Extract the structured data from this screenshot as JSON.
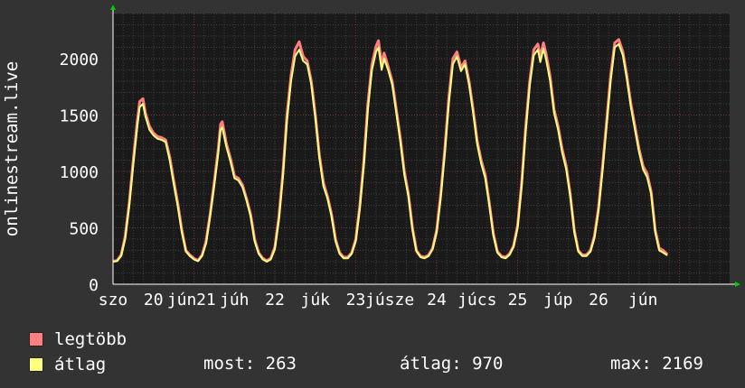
{
  "chart_data": {
    "type": "area",
    "ylabel": "onlinestream.live",
    "ylim": [
      0,
      2400
    ],
    "yticks": [
      0,
      500,
      1000,
      1500,
      2000
    ],
    "xlim": [
      0,
      7.62
    ],
    "xticks": [
      {
        "x": 0,
        "label": "szo"
      },
      {
        "x": 0.5,
        "label": "20"
      },
      {
        "x": 0.85,
        "label": "jún"
      },
      {
        "x": 1.15,
        "label": "21"
      },
      {
        "x": 1.5,
        "label": "júh"
      },
      {
        "x": 2.0,
        "label": "22"
      },
      {
        "x": 2.5,
        "label": "júk"
      },
      {
        "x": 3.0,
        "label": "23"
      },
      {
        "x": 3.42,
        "label": "júsze"
      },
      {
        "x": 4.0,
        "label": "24"
      },
      {
        "x": 4.5,
        "label": "júcs"
      },
      {
        "x": 5.0,
        "label": "25"
      },
      {
        "x": 5.5,
        "label": "júp"
      },
      {
        "x": 6.0,
        "label": "26"
      },
      {
        "x": 6.55,
        "label": "jún"
      }
    ],
    "grid": true,
    "series": [
      {
        "name": "legtöbb",
        "color": "#ff7f7f",
        "points": [
          [
            0.0,
            205
          ],
          [
            0.05,
            210
          ],
          [
            0.1,
            260
          ],
          [
            0.15,
            420
          ],
          [
            0.2,
            720
          ],
          [
            0.25,
            1100
          ],
          [
            0.3,
            1450
          ],
          [
            0.33,
            1620
          ],
          [
            0.37,
            1645
          ],
          [
            0.4,
            1520
          ],
          [
            0.45,
            1400
          ],
          [
            0.5,
            1340
          ],
          [
            0.55,
            1310
          ],
          [
            0.6,
            1300
          ],
          [
            0.65,
            1280
          ],
          [
            0.7,
            1130
          ],
          [
            0.75,
            920
          ],
          [
            0.8,
            720
          ],
          [
            0.85,
            480
          ],
          [
            0.9,
            300
          ],
          [
            0.95,
            260
          ],
          [
            1.0,
            230
          ],
          [
            1.05,
            210
          ],
          [
            1.1,
            260
          ],
          [
            1.15,
            380
          ],
          [
            1.2,
            620
          ],
          [
            1.25,
            900
          ],
          [
            1.3,
            1200
          ],
          [
            1.33,
            1420
          ],
          [
            1.35,
            1440
          ],
          [
            1.4,
            1250
          ],
          [
            1.45,
            1120
          ],
          [
            1.5,
            960
          ],
          [
            1.55,
            940
          ],
          [
            1.6,
            880
          ],
          [
            1.65,
            760
          ],
          [
            1.7,
            620
          ],
          [
            1.75,
            400
          ],
          [
            1.8,
            280
          ],
          [
            1.85,
            230
          ],
          [
            1.9,
            210
          ],
          [
            1.95,
            230
          ],
          [
            2.0,
            330
          ],
          [
            2.05,
            600
          ],
          [
            2.1,
            1000
          ],
          [
            2.15,
            1500
          ],
          [
            2.2,
            1850
          ],
          [
            2.25,
            2080
          ],
          [
            2.3,
            2150
          ],
          [
            2.35,
            2020
          ],
          [
            2.4,
            1980
          ],
          [
            2.45,
            1800
          ],
          [
            2.5,
            1500
          ],
          [
            2.55,
            1150
          ],
          [
            2.6,
            900
          ],
          [
            2.65,
            780
          ],
          [
            2.7,
            620
          ],
          [
            2.75,
            400
          ],
          [
            2.8,
            280
          ],
          [
            2.85,
            240
          ],
          [
            2.9,
            240
          ],
          [
            2.95,
            280
          ],
          [
            3.0,
            400
          ],
          [
            3.05,
            700
          ],
          [
            3.1,
            1100
          ],
          [
            3.15,
            1600
          ],
          [
            3.2,
            1950
          ],
          [
            3.25,
            2110
          ],
          [
            3.28,
            2160
          ],
          [
            3.32,
            1950
          ],
          [
            3.35,
            2050
          ],
          [
            3.4,
            1930
          ],
          [
            3.45,
            1800
          ],
          [
            3.5,
            1550
          ],
          [
            3.55,
            1300
          ],
          [
            3.6,
            1000
          ],
          [
            3.65,
            800
          ],
          [
            3.7,
            500
          ],
          [
            3.75,
            300
          ],
          [
            3.8,
            250
          ],
          [
            3.85,
            240
          ],
          [
            3.9,
            260
          ],
          [
            3.95,
            320
          ],
          [
            4.0,
            480
          ],
          [
            4.05,
            800
          ],
          [
            4.1,
            1200
          ],
          [
            4.15,
            1650
          ],
          [
            4.2,
            2000
          ],
          [
            4.25,
            2060
          ],
          [
            4.3,
            1920
          ],
          [
            4.35,
            1980
          ],
          [
            4.4,
            1800
          ],
          [
            4.45,
            1550
          ],
          [
            4.5,
            1270
          ],
          [
            4.55,
            1100
          ],
          [
            4.6,
            970
          ],
          [
            4.65,
            720
          ],
          [
            4.7,
            450
          ],
          [
            4.75,
            290
          ],
          [
            4.8,
            250
          ],
          [
            4.85,
            240
          ],
          [
            4.9,
            270
          ],
          [
            4.95,
            340
          ],
          [
            5.0,
            520
          ],
          [
            5.05,
            900
          ],
          [
            5.1,
            1400
          ],
          [
            5.15,
            1800
          ],
          [
            5.2,
            2080
          ],
          [
            5.25,
            2130
          ],
          [
            5.28,
            2020
          ],
          [
            5.32,
            2140
          ],
          [
            5.35,
            2050
          ],
          [
            5.4,
            1850
          ],
          [
            5.45,
            1550
          ],
          [
            5.5,
            1400
          ],
          [
            5.55,
            1200
          ],
          [
            5.6,
            1050
          ],
          [
            5.65,
            800
          ],
          [
            5.7,
            480
          ],
          [
            5.75,
            300
          ],
          [
            5.8,
            260
          ],
          [
            5.85,
            260
          ],
          [
            5.9,
            300
          ],
          [
            5.95,
            430
          ],
          [
            6.0,
            680
          ],
          [
            6.05,
            1050
          ],
          [
            6.1,
            1450
          ],
          [
            6.15,
            1850
          ],
          [
            6.2,
            2140
          ],
          [
            6.25,
            2170
          ],
          [
            6.3,
            2060
          ],
          [
            6.35,
            1850
          ],
          [
            6.4,
            1600
          ],
          [
            6.45,
            1400
          ],
          [
            6.5,
            1200
          ],
          [
            6.55,
            1050
          ],
          [
            6.6,
            980
          ],
          [
            6.65,
            820
          ],
          [
            6.7,
            480
          ],
          [
            6.75,
            320
          ],
          [
            6.8,
            300
          ],
          [
            6.85,
            263
          ]
        ]
      },
      {
        "name": "átlag",
        "color": "#ffff7f",
        "points": [
          [
            0.0,
            200
          ],
          [
            0.05,
            205
          ],
          [
            0.1,
            250
          ],
          [
            0.15,
            400
          ],
          [
            0.2,
            690
          ],
          [
            0.25,
            1060
          ],
          [
            0.3,
            1400
          ],
          [
            0.33,
            1570
          ],
          [
            0.37,
            1600
          ],
          [
            0.4,
            1490
          ],
          [
            0.45,
            1370
          ],
          [
            0.5,
            1320
          ],
          [
            0.55,
            1290
          ],
          [
            0.6,
            1280
          ],
          [
            0.65,
            1260
          ],
          [
            0.7,
            1100
          ],
          [
            0.75,
            890
          ],
          [
            0.8,
            690
          ],
          [
            0.85,
            460
          ],
          [
            0.9,
            290
          ],
          [
            0.95,
            250
          ],
          [
            1.0,
            220
          ],
          [
            1.05,
            205
          ],
          [
            1.1,
            250
          ],
          [
            1.15,
            360
          ],
          [
            1.2,
            600
          ],
          [
            1.25,
            870
          ],
          [
            1.3,
            1160
          ],
          [
            1.33,
            1370
          ],
          [
            1.35,
            1390
          ],
          [
            1.4,
            1220
          ],
          [
            1.45,
            1090
          ],
          [
            1.5,
            940
          ],
          [
            1.55,
            920
          ],
          [
            1.6,
            860
          ],
          [
            1.65,
            740
          ],
          [
            1.7,
            600
          ],
          [
            1.75,
            380
          ],
          [
            1.8,
            270
          ],
          [
            1.85,
            220
          ],
          [
            1.9,
            200
          ],
          [
            1.95,
            220
          ],
          [
            2.0,
            310
          ],
          [
            2.05,
            570
          ],
          [
            2.1,
            960
          ],
          [
            2.15,
            1450
          ],
          [
            2.2,
            1800
          ],
          [
            2.25,
            2020
          ],
          [
            2.3,
            2080
          ],
          [
            2.35,
            1980
          ],
          [
            2.4,
            1950
          ],
          [
            2.45,
            1770
          ],
          [
            2.5,
            1470
          ],
          [
            2.55,
            1120
          ],
          [
            2.6,
            870
          ],
          [
            2.65,
            760
          ],
          [
            2.7,
            600
          ],
          [
            2.75,
            380
          ],
          [
            2.8,
            270
          ],
          [
            2.85,
            230
          ],
          [
            2.9,
            230
          ],
          [
            2.95,
            270
          ],
          [
            3.0,
            380
          ],
          [
            3.05,
            670
          ],
          [
            3.1,
            1060
          ],
          [
            3.15,
            1550
          ],
          [
            3.2,
            1900
          ],
          [
            3.25,
            2060
          ],
          [
            3.28,
            2100
          ],
          [
            3.32,
            1900
          ],
          [
            3.35,
            2000
          ],
          [
            3.4,
            1900
          ],
          [
            3.45,
            1770
          ],
          [
            3.5,
            1520
          ],
          [
            3.55,
            1270
          ],
          [
            3.6,
            970
          ],
          [
            3.65,
            780
          ],
          [
            3.7,
            480
          ],
          [
            3.75,
            290
          ],
          [
            3.8,
            240
          ],
          [
            3.85,
            230
          ],
          [
            3.9,
            250
          ],
          [
            3.95,
            310
          ],
          [
            4.0,
            460
          ],
          [
            4.05,
            770
          ],
          [
            4.1,
            1160
          ],
          [
            4.15,
            1600
          ],
          [
            4.2,
            1950
          ],
          [
            4.25,
            2020
          ],
          [
            4.3,
            1890
          ],
          [
            4.35,
            1950
          ],
          [
            4.4,
            1770
          ],
          [
            4.45,
            1520
          ],
          [
            4.5,
            1240
          ],
          [
            4.55,
            1070
          ],
          [
            4.6,
            940
          ],
          [
            4.65,
            700
          ],
          [
            4.7,
            430
          ],
          [
            4.75,
            280
          ],
          [
            4.8,
            240
          ],
          [
            4.85,
            230
          ],
          [
            4.9,
            260
          ],
          [
            4.95,
            330
          ],
          [
            5.0,
            500
          ],
          [
            5.05,
            870
          ],
          [
            5.1,
            1360
          ],
          [
            5.15,
            1760
          ],
          [
            5.2,
            2030
          ],
          [
            5.25,
            2080
          ],
          [
            5.28,
            1970
          ],
          [
            5.32,
            2090
          ],
          [
            5.35,
            2000
          ],
          [
            5.4,
            1810
          ],
          [
            5.45,
            1520
          ],
          [
            5.5,
            1370
          ],
          [
            5.55,
            1170
          ],
          [
            5.6,
            1020
          ],
          [
            5.65,
            780
          ],
          [
            5.7,
            460
          ],
          [
            5.75,
            290
          ],
          [
            5.8,
            250
          ],
          [
            5.85,
            250
          ],
          [
            5.9,
            290
          ],
          [
            5.95,
            410
          ],
          [
            6.0,
            650
          ],
          [
            6.05,
            1010
          ],
          [
            6.1,
            1410
          ],
          [
            6.15,
            1800
          ],
          [
            6.2,
            2100
          ],
          [
            6.25,
            2130
          ],
          [
            6.3,
            2030
          ],
          [
            6.35,
            1820
          ],
          [
            6.4,
            1570
          ],
          [
            6.45,
            1370
          ],
          [
            6.5,
            1170
          ],
          [
            6.55,
            1020
          ],
          [
            6.6,
            950
          ],
          [
            6.65,
            800
          ],
          [
            6.7,
            460
          ],
          [
            6.75,
            300
          ],
          [
            6.8,
            280
          ],
          [
            6.85,
            255
          ]
        ]
      }
    ],
    "background": "#1a1a1a",
    "page_background": "#333333",
    "grid_minor_color": "#3d3d3d",
    "grid_major_color": "#6b3a3a",
    "axis_arrow_color": "#00cc00"
  },
  "legend": {
    "items": [
      {
        "label": "legtöbb",
        "color": "#ff7f7f"
      },
      {
        "label": "átlag",
        "color": "#ffff7f"
      }
    ],
    "most": "most: 263",
    "atlag": "átlag: 970",
    "max": "max: 2169"
  }
}
